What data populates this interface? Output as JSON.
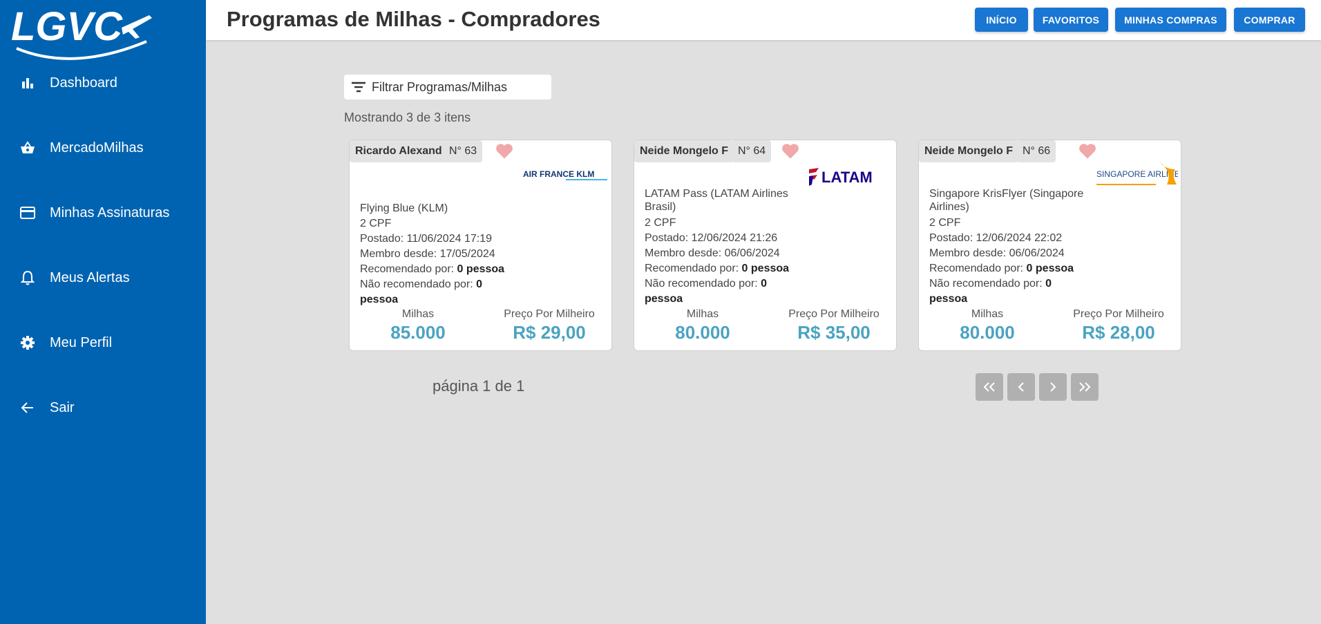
{
  "brand": {
    "logo_text": "LGVC"
  },
  "sidebar": {
    "items": [
      {
        "label": "Dashboard",
        "icon": "bar-chart-icon"
      },
      {
        "label": "MercadoMilhas",
        "icon": "basket-icon"
      },
      {
        "label": "Minhas Assinaturas",
        "icon": "credit-card-icon"
      },
      {
        "label": "Meus Alertas",
        "icon": "bell-icon"
      },
      {
        "label": "Meu Perfil",
        "icon": "gear-icon"
      },
      {
        "label": "Sair",
        "icon": "arrow-left-icon"
      }
    ]
  },
  "header": {
    "title": "Programas de Milhas - Compradores",
    "buttons": [
      "INÍCIO",
      "FAVORITOS",
      "MINHAS COMPRAS",
      "COMPRAR"
    ]
  },
  "filter": {
    "label": "Filtrar Programas/Milhas",
    "icon": "filter-icon"
  },
  "showing_text": "Mostrando 3 de 3 itens",
  "cards": [
    {
      "seller": "Ricardo Alexand",
      "number": "N° 63",
      "logo": "AIR FRANCE KLM",
      "program": "Flying Blue (KLM)",
      "cpf": "2 CPF",
      "posted": "Postado: 11/06/2024 17:19",
      "member_since": "Membro desde: 17/05/2024",
      "recommended_label": "Recomendado por:",
      "recommended_value": "0 pessoa",
      "not_recommended_label": "Não recomendado por:",
      "not_recommended_value": "0 pessoa",
      "miles_label": "Milhas",
      "miles_value": "85.000",
      "price_label": "Preço Por Milheiro",
      "price_value": "R$ 29,00"
    },
    {
      "seller": "Neide Mongelo F",
      "number": "N° 64",
      "logo": "LATAM",
      "program": "LATAM Pass (LATAM Airlines Brasil)",
      "cpf": "2 CPF",
      "posted": "Postado: 12/06/2024 21:26",
      "member_since": "Membro desde: 06/06/2024",
      "recommended_label": "Recomendado por:",
      "recommended_value": "0 pessoa",
      "not_recommended_label": "Não recomendado por:",
      "not_recommended_value": "0 pessoa",
      "miles_label": "Milhas",
      "miles_value": "80.000",
      "price_label": "Preço Por Milheiro",
      "price_value": "R$ 35,00"
    },
    {
      "seller": "Neide Mongelo F",
      "number": "N° 66",
      "logo": "SINGAPORE AIRLINES",
      "program": "Singapore KrisFlyer (Singapore Airlines)",
      "cpf": "2 CPF",
      "posted": "Postado: 12/06/2024 22:02",
      "member_since": "Membro desde: 06/06/2024",
      "recommended_label": "Recomendado por:",
      "recommended_value": "0 pessoa",
      "not_recommended_label": "Não recomendado por:",
      "not_recommended_value": "0 pessoa",
      "miles_label": "Milhas",
      "miles_value": "80.000",
      "price_label": "Preço Por Milheiro",
      "price_value": "R$ 28,00"
    }
  ],
  "pagination": {
    "page_text": "página 1 de 1",
    "buttons": [
      "first-page-icon",
      "prev-page-icon",
      "next-page-icon",
      "last-page-icon"
    ]
  },
  "colors": {
    "sidebar": "#0063b1",
    "header_button": "#1976d2",
    "value_accent": "#4aa3c2",
    "heart": "#f1a8a8",
    "page_background": "#e0e0e0"
  }
}
